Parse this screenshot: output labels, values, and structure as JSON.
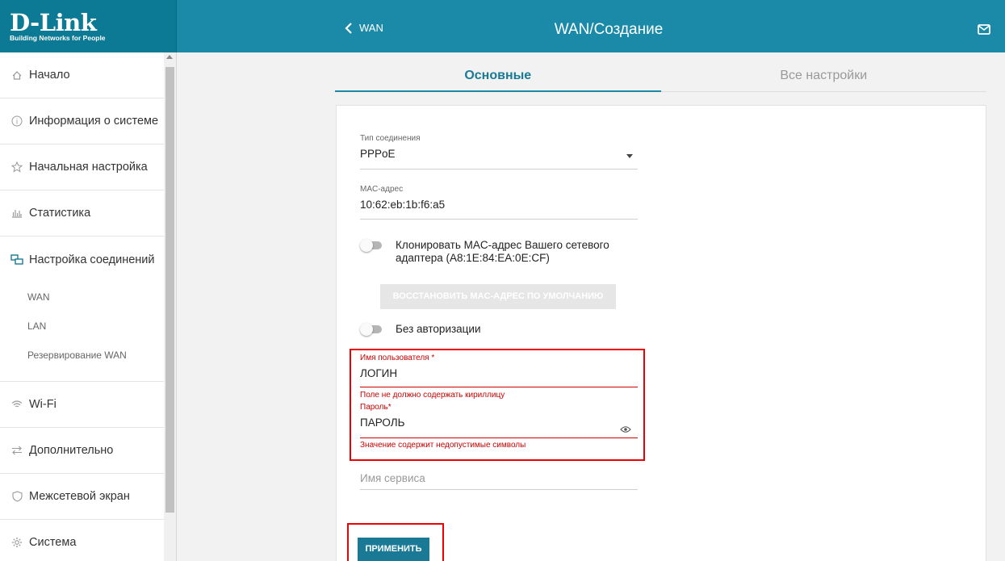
{
  "logo": {
    "brand": "D-Link",
    "tagline": "Building Networks for People"
  },
  "header": {
    "back_label": "WAN",
    "title": "WAN/Создание"
  },
  "sidebar": {
    "items": [
      {
        "label": "Начало",
        "icon": "home-icon"
      },
      {
        "label": "Информация о системе",
        "icon": "info-icon"
      },
      {
        "label": "Начальная настройка",
        "icon": "star-icon"
      },
      {
        "label": "Статистика",
        "icon": "stats-icon"
      },
      {
        "label": "Настройка соединений",
        "icon": "connections-icon"
      },
      {
        "label": "Wi-Fi",
        "icon": "wifi-icon"
      },
      {
        "label": "Дополнительно",
        "icon": "advanced-icon"
      },
      {
        "label": "Межсетевой экран",
        "icon": "shield-icon"
      },
      {
        "label": "Система",
        "icon": "gear-icon"
      }
    ],
    "subitems": [
      "WAN",
      "LAN",
      "Резервирование WAN"
    ]
  },
  "tabs": [
    {
      "label": "Основные",
      "active": true
    },
    {
      "label": "Все настройки",
      "active": false
    }
  ],
  "form": {
    "conn_type": {
      "label": "Тип соединения",
      "value": "PPPoE"
    },
    "mac": {
      "label": "MAC-адрес",
      "value": "10:62:eb:1b:f6:a5"
    },
    "clone_mac": {
      "label": "Клонировать MAC-адрес Вашего сетевого адаптера (A8:1E:84:EA:0E:CF)",
      "on": false
    },
    "restore_btn": "ВОССТАНОВИТЬ MAC-АДРЕС ПО УМОЛЧАНИЮ",
    "no_auth": {
      "label": "Без авторизации",
      "on": false
    },
    "username": {
      "label": "Имя пользователя *",
      "value": "ЛОГИН",
      "error": "Поле не должно содержать кириллицу"
    },
    "password": {
      "label": "Пароль*",
      "value": "ПАРОЛЬ",
      "error": "Значение содержит недопустимые символы"
    },
    "service": {
      "placeholder": "Имя сервиса"
    },
    "apply": "ПРИМЕНИТЬ"
  },
  "colors": {
    "header": "#1a8aa8",
    "logo_bg": "#0d7a95",
    "accent": "#1a7a96",
    "error": "#cc0000",
    "highlight": "#e00000"
  }
}
